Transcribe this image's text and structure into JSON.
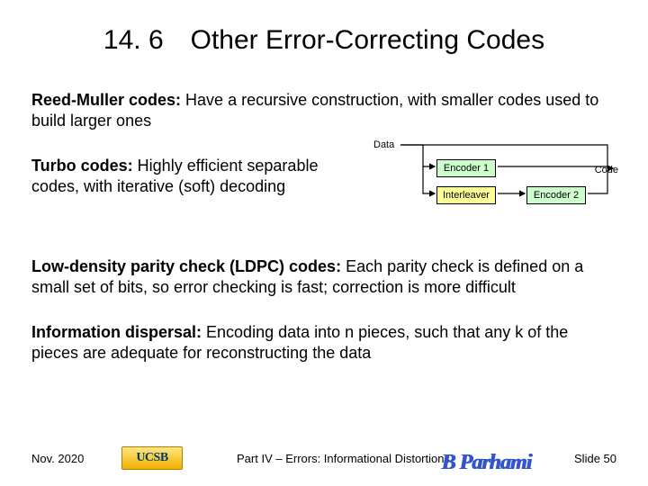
{
  "title": "14. 6 Other Error-Correcting Codes",
  "reed_muller": {
    "label": "Reed-Muller codes:",
    "text": " Have a recursive construction, with smaller codes used to build larger ones"
  },
  "turbo": {
    "label": "Turbo codes:",
    "text": " Highly efficient separable codes, with iterative (soft) decoding"
  },
  "diagram": {
    "data": "Data",
    "encoder1": "Encoder 1",
    "interleaver": "Interleaver",
    "encoder2": "Encoder 2",
    "code": "Code"
  },
  "ldpc": {
    "label": "Low-density parity check (LDPC) codes:",
    "text": " Each parity check is defined on a small set of bits, so error checking is fast; correction is more difficult"
  },
  "dispersal": {
    "label": "Information dispersal:",
    "text": " Encoding data into n pieces, such that any k of the pieces are adequate for reconstructing the data"
  },
  "footer": {
    "date": "Nov. 2020",
    "logo": "UCSB",
    "part": "Part IV – Errors: Informational Distortions",
    "author": "B Parhami",
    "slide": "Slide 50"
  }
}
